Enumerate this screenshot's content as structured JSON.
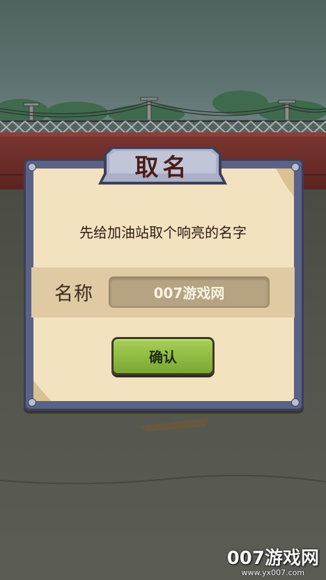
{
  "dialog": {
    "title": "取名",
    "prompt": "先给加油站取个响亮的名字",
    "name_label": "名称",
    "name_value": "007游戏网",
    "confirm_label": "确认"
  },
  "watermark": {
    "brand": "007游戏网",
    "url": "www.yx007.com"
  },
  "colors": {
    "frame": "#5b6286",
    "paper": "#f3e2c0",
    "button": "#8dba41",
    "wall": "#6a2b27"
  }
}
